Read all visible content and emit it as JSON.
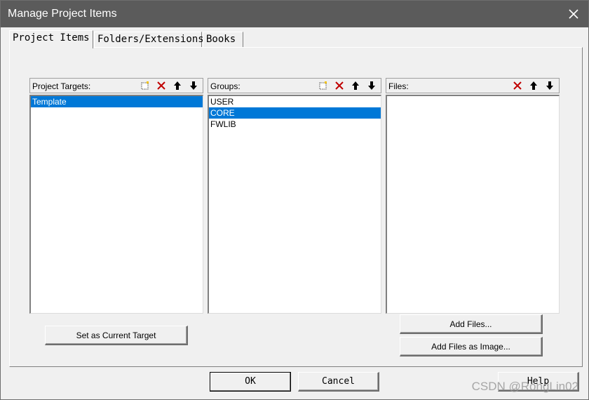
{
  "window": {
    "title": "Manage Project Items"
  },
  "tabs": [
    {
      "label": "Project Items",
      "active": true
    },
    {
      "label": "Folders/Extensions",
      "active": false
    },
    {
      "label": "Books",
      "active": false
    }
  ],
  "panels": {
    "targets": {
      "label": "Project Targets:",
      "items": [
        {
          "text": "Template",
          "selected": true
        }
      ],
      "tools": [
        "new-icon",
        "delete-icon",
        "move-up-icon",
        "move-down-icon"
      ]
    },
    "groups": {
      "label": "Groups:",
      "items": [
        {
          "text": "USER",
          "selected": false
        },
        {
          "text": "CORE",
          "selected": true
        },
        {
          "text": "FWLIB",
          "selected": false
        }
      ],
      "tools": [
        "new-icon",
        "delete-icon",
        "move-up-icon",
        "move-down-icon"
      ]
    },
    "files": {
      "label": "Files:",
      "items": [],
      "tools": [
        "delete-icon",
        "move-up-icon",
        "move-down-icon"
      ]
    }
  },
  "buttons": {
    "set_current_target": "Set as Current Target",
    "add_files": "Add Files...",
    "add_files_image": "Add Files as Image...",
    "ok": "OK",
    "cancel": "Cancel",
    "help": "Help"
  },
  "watermark": "CSDN @RongLin02",
  "colors": {
    "selection": "#0078d7",
    "titlebar": "#5b5b5b",
    "delete": "#c00000"
  }
}
